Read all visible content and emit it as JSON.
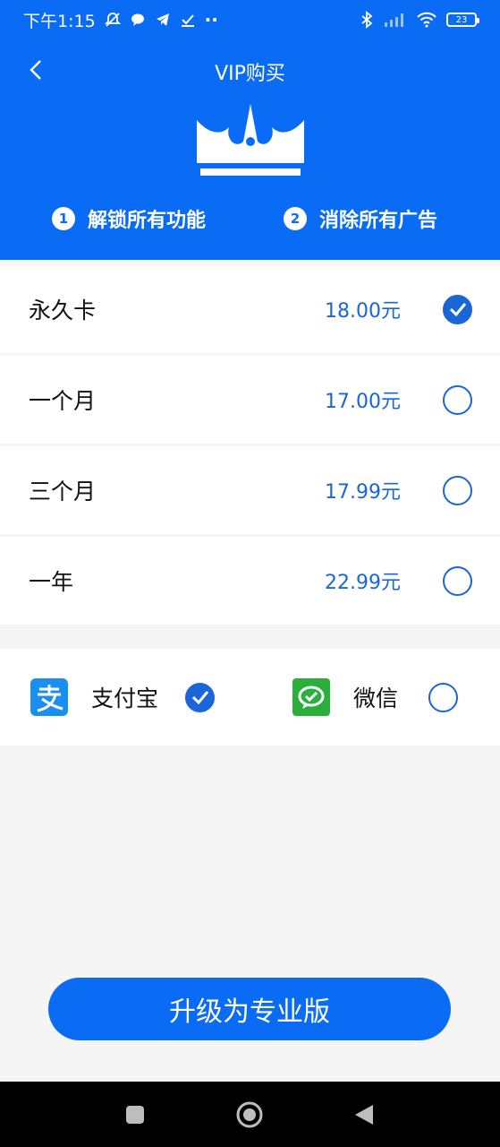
{
  "statusbar": {
    "time": "下午1:15",
    "dots": "··",
    "battery": "23"
  },
  "header": {
    "title": "VIP购买",
    "features": [
      {
        "num": "1",
        "label": "解锁所有功能"
      },
      {
        "num": "2",
        "label": "消除所有广告"
      }
    ]
  },
  "plans": [
    {
      "name": "永久卡",
      "price": "18.00元",
      "selected": true
    },
    {
      "name": "一个月",
      "price": "17.00元",
      "selected": false
    },
    {
      "name": "三个月",
      "price": "17.99元",
      "selected": false
    },
    {
      "name": "一年",
      "price": "22.99元",
      "selected": false
    }
  ],
  "payments": [
    {
      "label": "支付宝",
      "icon": "alipay-icon",
      "selected": true
    },
    {
      "label": "微信",
      "icon": "wechat-icon",
      "selected": false
    }
  ],
  "upgrade": {
    "label": "升级为专业版"
  },
  "colors": {
    "brand": "#0a6cf5",
    "price": "#1a66d6",
    "alipay": "#1a8ff0",
    "wechat": "#2aae3c"
  }
}
